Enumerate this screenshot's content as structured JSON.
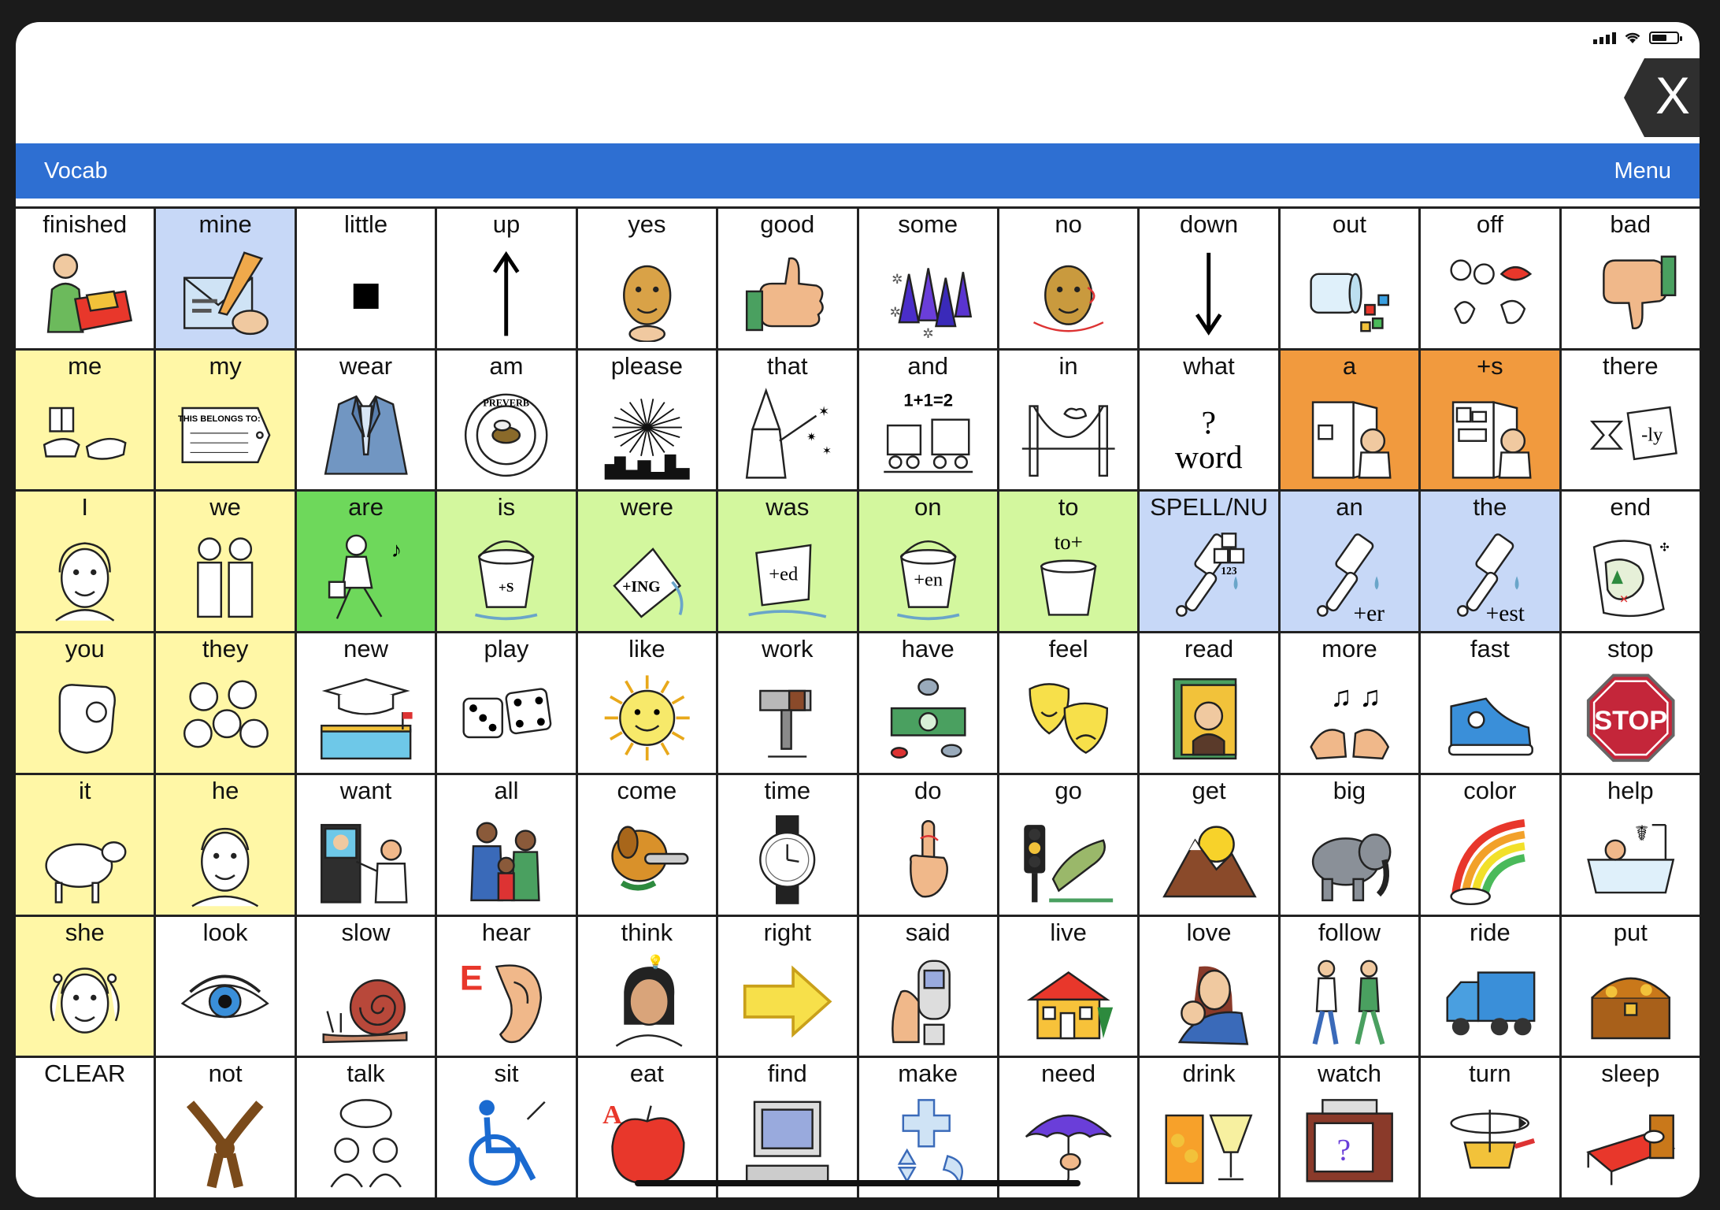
{
  "toolbar": {
    "vocab_label": "Vocab",
    "menu_label": "Menu",
    "close_label": "X"
  },
  "colors": {
    "bar": "#2e6fd2",
    "yellow": "#fff7a6",
    "green": "#d3f79e",
    "are_green": "#6ed85b",
    "blue": "#c7d8f7",
    "orange": "#f19a3e"
  },
  "grid": {
    "rows": [
      {
        "cells": [
          {
            "label": "finished",
            "color": "white",
            "icon": "person-packing-box-icon"
          },
          {
            "label": "mine",
            "color": "blue",
            "icon": "letter-pen-icon"
          },
          {
            "label": "little",
            "color": "white",
            "icon": "small-square-icon"
          },
          {
            "label": "up",
            "color": "white",
            "icon": "arrow-up-icon"
          },
          {
            "label": "yes",
            "color": "white",
            "icon": "nodding-head-icon"
          },
          {
            "label": "good",
            "color": "white",
            "icon": "thumbs-up-icon"
          },
          {
            "label": "some",
            "color": "white",
            "icon": "cones-icon"
          },
          {
            "label": "no",
            "color": "white",
            "icon": "shaking-head-icon"
          },
          {
            "label": "down",
            "color": "white",
            "icon": "arrow-down-icon"
          },
          {
            "label": "out",
            "color": "white",
            "icon": "spilled-cup-icon"
          },
          {
            "label": "off",
            "color": "white",
            "icon": "off-switch-icon"
          },
          {
            "label": "bad",
            "color": "white",
            "icon": "thumbs-down-icon"
          }
        ]
      },
      {
        "cells": [
          {
            "label": "me",
            "color": "yellow",
            "icon": "gift-hands-icon"
          },
          {
            "label": "my",
            "color": "yellow",
            "icon": "name-tag-icon",
            "icon_text": "THIS BELONGS TO:"
          },
          {
            "label": "wear",
            "color": "white",
            "icon": "suit-jacket-icon"
          },
          {
            "label": "am",
            "color": "white",
            "icon": "preverb-bee-icon",
            "icon_text": "PREVERB"
          },
          {
            "label": "please",
            "color": "white",
            "icon": "fireworks-icon"
          },
          {
            "label": "that",
            "color": "white",
            "icon": "wizard-icon"
          },
          {
            "label": "and",
            "color": "white",
            "icon": "train-plus-icon",
            "icon_text": "1+1=2"
          },
          {
            "label": "in",
            "color": "white",
            "icon": "bridge-icon"
          },
          {
            "label": "what",
            "color": "white",
            "icon": "question-word-icon",
            "icon_text": "?",
            "icon_text2": "word"
          },
          {
            "label": "a",
            "color": "orange",
            "icon": "man-fridge-icon"
          },
          {
            "label": "+s",
            "color": "orange",
            "icon": "man-fridge-full-icon"
          },
          {
            "label": "there",
            "color": "white",
            "icon": "hourglass-ly-icon",
            "icon_text": "-ly"
          }
        ]
      },
      {
        "cells": [
          {
            "label": "I",
            "color": "yellow",
            "icon": "woman-self-icon"
          },
          {
            "label": "we",
            "color": "yellow",
            "icon": "two-people-icon"
          },
          {
            "label": "are",
            "color": "are_green",
            "icon": "walking-painter-icon"
          },
          {
            "label": "is",
            "color": "green",
            "icon": "bucket-s-icon",
            "icon_text": "+S"
          },
          {
            "label": "were",
            "color": "green",
            "icon": "bucket-ing-icon",
            "icon_text": "+ING"
          },
          {
            "label": "was",
            "color": "green",
            "icon": "bucket-ed-icon",
            "icon_text": "+ed"
          },
          {
            "label": "on",
            "color": "green",
            "icon": "bucket-en-icon",
            "icon_text": "+en"
          },
          {
            "label": "to",
            "color": "green",
            "icon": "bucket-to-icon",
            "icon_text": "to+"
          },
          {
            "label": "SPELL/NU",
            "color": "blue",
            "icon": "brush-numbers-icon",
            "icon_text": "123"
          },
          {
            "label": "an",
            "color": "blue",
            "icon": "brush-er-icon",
            "icon_text": "+er"
          },
          {
            "label": "the",
            "color": "blue",
            "icon": "brush-est-icon",
            "icon_text": "+est"
          },
          {
            "label": "end",
            "color": "white",
            "icon": "treasure-map-icon"
          }
        ]
      },
      {
        "cells": [
          {
            "label": "you",
            "color": "yellow",
            "icon": "pointing-hand-icon"
          },
          {
            "label": "they",
            "color": "yellow",
            "icon": "group-faces-icon"
          },
          {
            "label": "new",
            "color": "white",
            "icon": "graduation-school-icon"
          },
          {
            "label": "play",
            "color": "white",
            "icon": "dice-icon"
          },
          {
            "label": "like",
            "color": "white",
            "icon": "smiling-sun-icon"
          },
          {
            "label": "work",
            "color": "white",
            "icon": "hammer-icon"
          },
          {
            "label": "have",
            "color": "white",
            "icon": "money-icon"
          },
          {
            "label": "feel",
            "color": "white",
            "icon": "theater-masks-icon"
          },
          {
            "label": "read",
            "color": "white",
            "icon": "book-icon"
          },
          {
            "label": "more",
            "color": "white",
            "icon": "music-hands-icon"
          },
          {
            "label": "fast",
            "color": "white",
            "icon": "sneaker-icon"
          },
          {
            "label": "stop",
            "color": "white",
            "icon": "stop-sign-icon",
            "icon_text": "STOP"
          }
        ]
      },
      {
        "cells": [
          {
            "label": "it",
            "color": "yellow",
            "icon": "sheep-icon"
          },
          {
            "label": "he",
            "color": "yellow",
            "icon": "boy-face-icon"
          },
          {
            "label": "want",
            "color": "white",
            "icon": "vending-machine-icon"
          },
          {
            "label": "all",
            "color": "white",
            "icon": "family-icon"
          },
          {
            "label": "come",
            "color": "white",
            "icon": "dog-bone-icon"
          },
          {
            "label": "time",
            "color": "white",
            "icon": "watch-icon"
          },
          {
            "label": "do",
            "color": "white",
            "icon": "finger-string-icon"
          },
          {
            "label": "go",
            "color": "white",
            "icon": "frog-traffic-light-icon"
          },
          {
            "label": "get",
            "color": "white",
            "icon": "mountain-sun-icon"
          },
          {
            "label": "big",
            "color": "white",
            "icon": "elephant-icon"
          },
          {
            "label": "color",
            "color": "white",
            "icon": "rainbow-icon"
          },
          {
            "label": "help",
            "color": "white",
            "icon": "bathtub-icon"
          }
        ]
      },
      {
        "cells": [
          {
            "label": "she",
            "color": "yellow",
            "icon": "girl-face-icon"
          },
          {
            "label": "look",
            "color": "white",
            "icon": "eye-icon"
          },
          {
            "label": "slow",
            "color": "white",
            "icon": "snail-icon"
          },
          {
            "label": "hear",
            "color": "white",
            "icon": "ear-icon",
            "icon_text": "E"
          },
          {
            "label": "think",
            "color": "white",
            "icon": "thinking-woman-icon"
          },
          {
            "label": "right",
            "color": "white",
            "icon": "arrow-right-icon"
          },
          {
            "label": "said",
            "color": "white",
            "icon": "phone-hand-icon"
          },
          {
            "label": "live",
            "color": "white",
            "icon": "house-icon"
          },
          {
            "label": "love",
            "color": "white",
            "icon": "mother-baby-icon"
          },
          {
            "label": "follow",
            "color": "white",
            "icon": "walking-people-icon"
          },
          {
            "label": "ride",
            "color": "white",
            "icon": "truck-icon"
          },
          {
            "label": "put",
            "color": "white",
            "icon": "treasure-chest-icon"
          }
        ]
      },
      {
        "cells": [
          {
            "label": "CLEAR",
            "color": "white",
            "icon": ""
          },
          {
            "label": "not",
            "color": "white",
            "icon": "knot-rope-icon"
          },
          {
            "label": "talk",
            "color": "white",
            "icon": "talking-people-icon"
          },
          {
            "label": "sit",
            "color": "white",
            "icon": "wheelchair-icon"
          },
          {
            "label": "eat",
            "color": "white",
            "icon": "apple-icon",
            "icon_text": "A"
          },
          {
            "label": "find",
            "color": "white",
            "icon": "computer-icon"
          },
          {
            "label": "make",
            "color": "white",
            "icon": "shapes-icon"
          },
          {
            "label": "need",
            "color": "white",
            "icon": "umbrella-icon"
          },
          {
            "label": "drink",
            "color": "white",
            "icon": "juice-glass-icon"
          },
          {
            "label": "watch",
            "color": "white",
            "icon": "television-icon",
            "icon_text": "?"
          },
          {
            "label": "turn",
            "color": "white",
            "icon": "pan-turn-icon"
          },
          {
            "label": "sleep",
            "color": "white",
            "icon": "bed-icon"
          }
        ]
      }
    ]
  }
}
